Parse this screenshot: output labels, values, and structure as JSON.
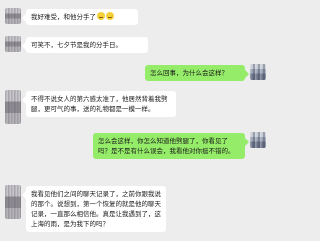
{
  "messages": [
    {
      "side": "left",
      "text": "我好难受，和他分手了"
    },
    {
      "side": "left",
      "text": "可笑不，七夕节是我的分手日。"
    },
    {
      "side": "right",
      "text": "怎么回事，为什么会这样？"
    },
    {
      "side": "left",
      "text": "不得不说女人的第六感太准了，他居然背着我劈腿，更可气的事，送的礼物都是一模一样。"
    },
    {
      "side": "right",
      "text": "怎么会这样，你怎么知道他劈腿了，你看见了吗？是不是有什么误会，我看他对你挺不错的。"
    },
    {
      "side": "left",
      "text": "我看见他们之间的聊天记录了，之前你跟我说的那个。说想到，第一个恢复的就是他的聊天记录，一直那么相信他。真是让我遇到了，这上海的雨，是为我下的吗？"
    }
  ],
  "emoji_names": [
    "crying-face-emoji",
    "crying-face-emoji"
  ]
}
